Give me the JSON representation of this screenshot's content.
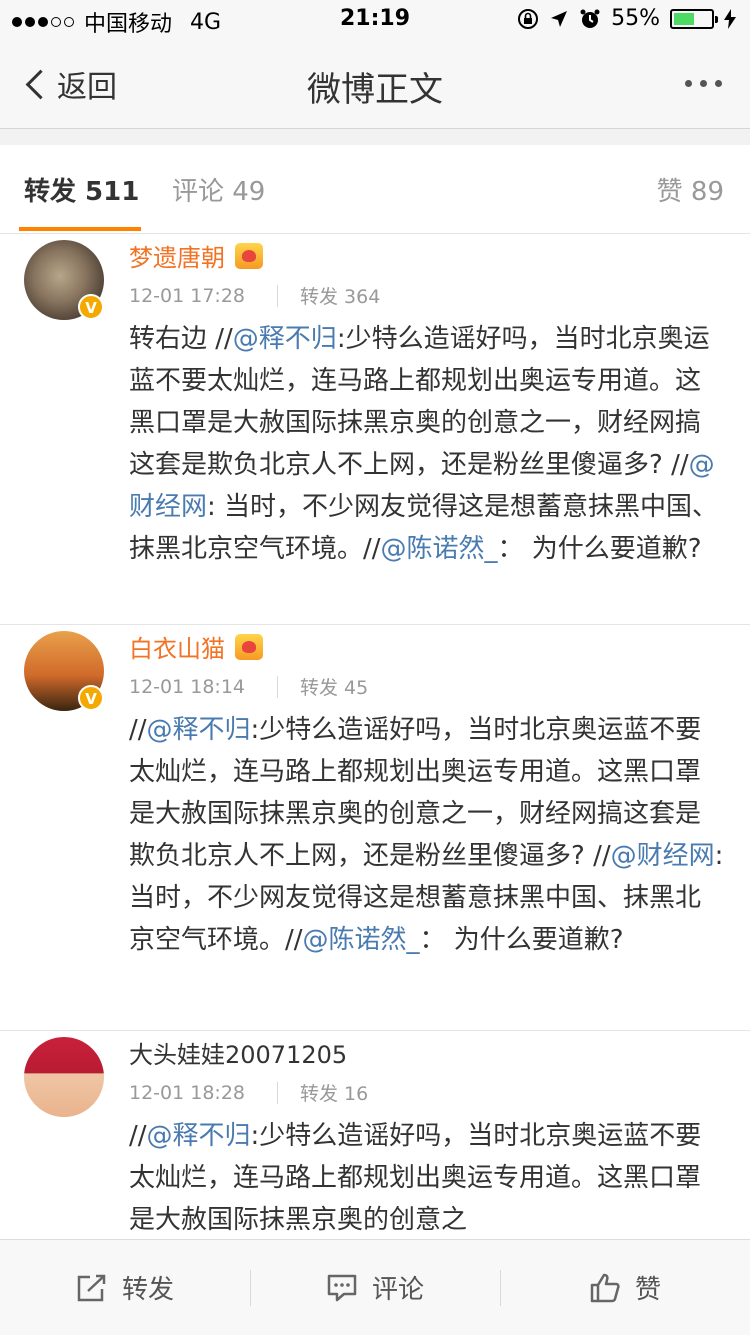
{
  "status_bar": {
    "carrier": "中国移动",
    "network": "4G",
    "time": "21:19",
    "battery": "55%",
    "battery_level": 0.55
  },
  "nav": {
    "back_label": "返回",
    "title": "微博正文"
  },
  "tabs": {
    "repost": "转发 511",
    "comment": "评论 49",
    "like": "赞 89"
  },
  "reposts": [
    {
      "name": "梦遗唐朝",
      "time": "12-01 17:28",
      "count": "转发 364",
      "segments": [
        {
          "text": "转右边 //",
          "mention": false
        },
        {
          "text": "@释不归",
          "mention": true
        },
        {
          "text": ":少特么造谣好吗，当时北京奥运蓝不要太灿烂，连马路上都规划出奥运专用道。这黑口罩是大赦国际抹黑京奥的创意之一，财经网搞这套是欺负北京人不上网，还是粉丝里傻逼多? //",
          "mention": false
        },
        {
          "text": "@财经网",
          "mention": true
        },
        {
          "text": ": 当时，不少网友觉得这是想蓄意抹黑中国、抹黑北京空气环境。//",
          "mention": false
        },
        {
          "text": "@陈诺然_",
          "mention": true
        },
        {
          "text": "： 为什么要道歉?",
          "mention": false
        }
      ]
    },
    {
      "name": "白衣山猫",
      "time": "12-01 18:14",
      "count": "转发 45",
      "segments": [
        {
          "text": "//",
          "mention": false
        },
        {
          "text": "@释不归",
          "mention": true
        },
        {
          "text": ":少特么造谣好吗，当时北京奥运蓝不要太灿烂，连马路上都规划出奥运专用道。这黑口罩是大赦国际抹黑京奥的创意之一，财经网搞这套是欺负北京人不上网，还是粉丝里傻逼多? //",
          "mention": false
        },
        {
          "text": "@财经网",
          "mention": true
        },
        {
          "text": ": 当时，不少网友觉得这是想蓄意抹黑中国、抹黑北京空气环境。//",
          "mention": false
        },
        {
          "text": "@陈诺然_",
          "mention": true
        },
        {
          "text": "： 为什么要道歉?",
          "mention": false
        }
      ]
    },
    {
      "name": "大头娃娃20071205",
      "time": "12-01 18:28",
      "count": "转发 16",
      "segments": [
        {
          "text": "//",
          "mention": false
        },
        {
          "text": "@释不归",
          "mention": true
        },
        {
          "text": ":少特么造谣好吗，当时北京奥运蓝不要太灿烂，连马路上都规划出奥运专用道。这黑口罩是大赦国际抹黑京奥的创意之",
          "mention": false
        }
      ]
    }
  ],
  "toolbar": {
    "repost": "转发",
    "comment": "评论",
    "like": "赞"
  }
}
